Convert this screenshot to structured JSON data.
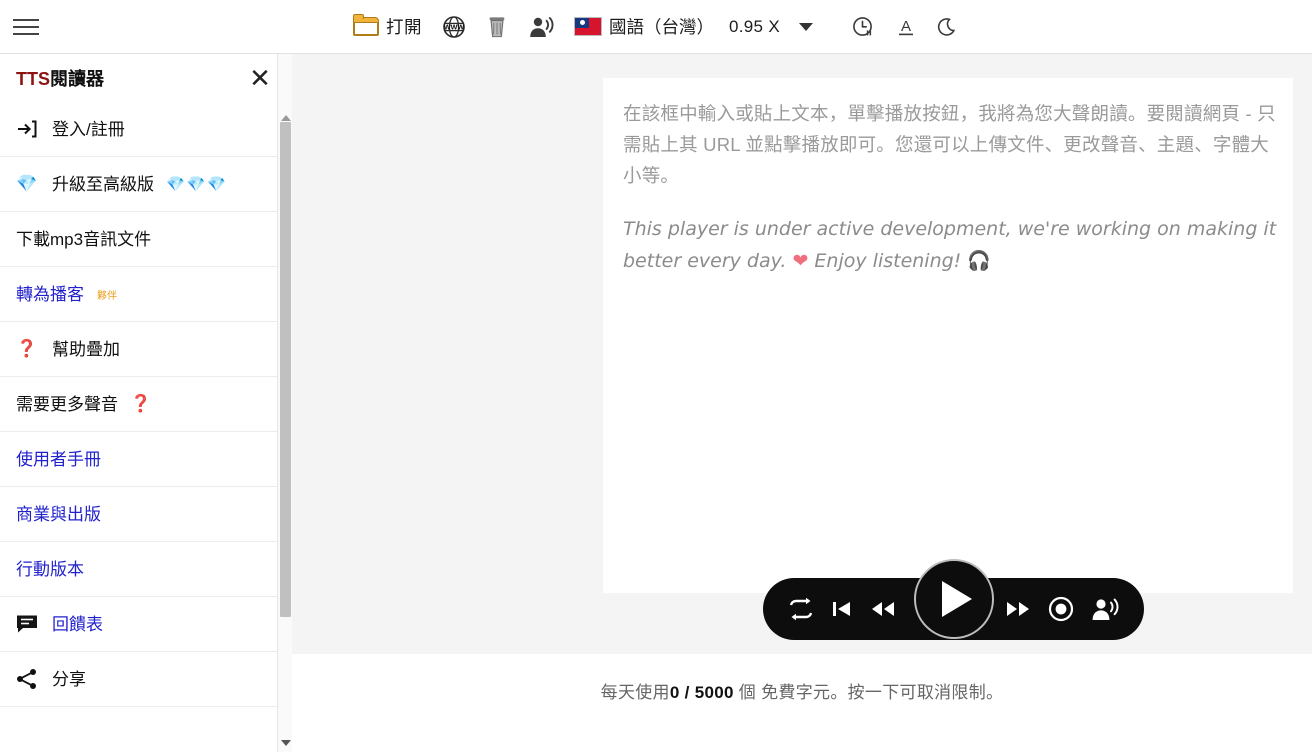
{
  "topbar": {
    "menu_icon": "hamburger-icon",
    "tools": [
      {
        "icon": "folder-open-icon",
        "label": "打開"
      },
      {
        "icon": "globe-www-icon",
        "label": ""
      },
      {
        "icon": "trash-icon",
        "label": ""
      },
      {
        "icon": "voice-person-icon",
        "label": ""
      }
    ],
    "language": {
      "flag": "taiwan-flag-icon",
      "name": "國語（台灣）",
      "rate": "0.95 X",
      "caret": "chevron-down-icon"
    },
    "right_icons": [
      {
        "icon": "sleep-timer-icon"
      },
      {
        "icon": "font-format-icon"
      },
      {
        "icon": "dark-mode-moon-icon"
      }
    ]
  },
  "sidebar": {
    "title_accent": "TTS",
    "title_rest": "閱讀器",
    "close_label": "✕",
    "items": [
      {
        "icon": "login-arrow-icon",
        "label": "登入/註冊",
        "style": "dark"
      },
      {
        "icon": "gem-icon",
        "label": "升級至高級版",
        "gems": "💎💎💎",
        "style": "dark"
      },
      {
        "icon": "",
        "label": "下載mp3音訊文件",
        "style": "dark"
      },
      {
        "icon": "",
        "label": "轉為播客",
        "sup": "夥伴",
        "style": "blue"
      },
      {
        "icon": "question-mark-icon",
        "label": "幫助疊加",
        "style": "dark"
      },
      {
        "icon": "",
        "label": "需要更多聲音",
        "trail_q": "❓",
        "style": "dark"
      },
      {
        "icon": "",
        "label": "使用者手冊",
        "style": "blue"
      },
      {
        "icon": "",
        "label": "商業與出版",
        "style": "blue"
      },
      {
        "icon": "",
        "label": "行動版本",
        "style": "blue"
      },
      {
        "icon": "feedback-chat-icon",
        "label": "回饋表",
        "style": "blue"
      },
      {
        "icon": "share-icon",
        "label": "分享",
        "style": "dark"
      }
    ],
    "scrollbar": {
      "up_arrow": "scroll-up-arrow",
      "down_arrow": "scroll-down-arrow"
    }
  },
  "editor": {
    "placeholder_zh": "在該框中輸入或貼上文本，單擊播放按鈕，我將為您大聲朗讀。要閱讀網頁 - 只需貼上其 URL 並點擊播放即可。您還可以上傳文件、更改聲音、主題、字體大小等。",
    "note_en_part1": "This player is under active development, we're working on making it better every day. ",
    "note_heart": "❤",
    "note_en_part2": " Enjoy listening! ",
    "note_headphones": "🎧"
  },
  "player": {
    "buttons": [
      {
        "icon": "repeat-loop-icon",
        "name": "repeat-button"
      },
      {
        "icon": "previous-track-icon",
        "name": "previous-button"
      },
      {
        "icon": "rewind-icon",
        "name": "rewind-button"
      },
      {
        "icon": "play-icon",
        "name": "play-button"
      },
      {
        "icon": "fast-forward-icon",
        "name": "forward-button"
      },
      {
        "icon": "record-circle-icon",
        "name": "record-button"
      },
      {
        "icon": "voice-person-icon",
        "name": "voice-button"
      }
    ]
  },
  "status": {
    "prefix": "每天使用",
    "used": "0",
    "slash": "/",
    "limit": "5000",
    "unit": "個",
    "free_chars": "免費字元。",
    "suffix": "按一下可取消限制。"
  },
  "colors": {
    "accent_red": "#8d1212",
    "link_blue": "#2222cc",
    "partner_orange": "#e8a020",
    "player_black": "#0d0d0d",
    "page_gray": "#f4f4f4"
  }
}
